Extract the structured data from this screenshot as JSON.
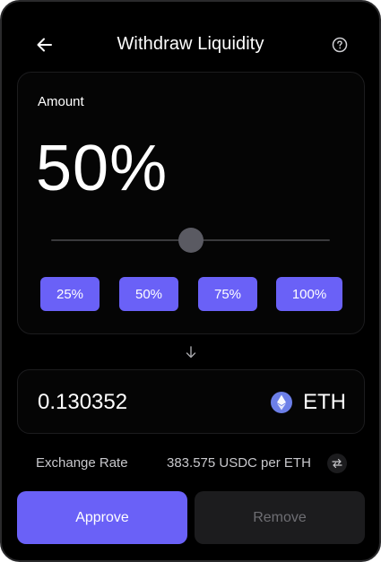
{
  "header": {
    "title": "Withdraw Liquidity",
    "back_icon": "arrow-left-icon",
    "help_icon": "question-circle-icon"
  },
  "amount": {
    "label": "Amount",
    "value": "50%",
    "slider_fraction": 0.5,
    "presets": [
      "25%",
      "50%",
      "75%",
      "100%"
    ]
  },
  "output": {
    "value": "0.130352",
    "token_symbol": "ETH",
    "token_icon": "ethereum-icon"
  },
  "exchange_rate": {
    "label": "Exchange Rate",
    "value": "383.575 USDC per ETH",
    "swap_icon": "swap-arrows-icon"
  },
  "actions": {
    "approve_label": "Approve",
    "remove_label": "Remove"
  },
  "colors": {
    "accent": "#6a61f7",
    "background": "#000000",
    "card_border": "#1c1c1e",
    "disabled_text": "#6e6e73"
  }
}
